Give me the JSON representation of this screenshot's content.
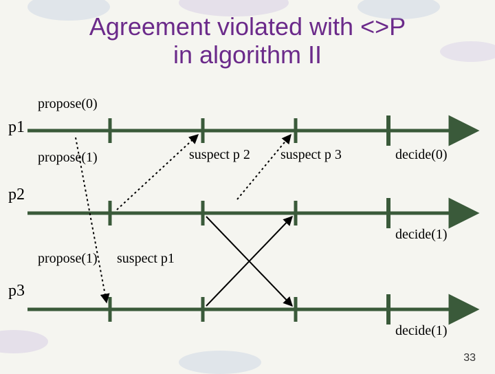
{
  "title_line1": "Agreement violated with <>P",
  "title_line2": "in algorithm II",
  "labels": {
    "propose0": "propose(0)",
    "propose1_a": "propose(1)",
    "propose1_b": "propose(1)",
    "suspect_p1": "suspect p1",
    "suspect_p2": "suspect p 2",
    "suspect_p3": "suspect p 3",
    "decide0": "decide(0)",
    "decide1_a": "decide(1)",
    "decide1_b": "decide(1)",
    "p1": "p1",
    "p2": "p2",
    "p3": "p3"
  },
  "page_number": "33",
  "chart_data": {
    "type": "timeline-diagram",
    "processes": [
      "p1",
      "p2",
      "p3"
    ],
    "rounds": 4,
    "events": [
      {
        "process": "p1",
        "action": "propose(0)"
      },
      {
        "process": "p2",
        "action": "propose(1)"
      },
      {
        "process": "p3",
        "action": "propose(1)"
      },
      {
        "process": "p1",
        "round": 2,
        "action": "suspect p2"
      },
      {
        "process": "p1",
        "round": 3,
        "action": "suspect p3"
      },
      {
        "process": "p3",
        "round": 1,
        "action": "suspect p1"
      },
      {
        "process": "p1",
        "round": 4,
        "action": "decide(0)"
      },
      {
        "process": "p2",
        "round": 4,
        "action": "decide(1)"
      },
      {
        "process": "p3",
        "round": 4,
        "action": "decide(1)"
      }
    ],
    "messages": [
      {
        "from": "p2",
        "to": "p1",
        "at_round": 2,
        "style": "dotted"
      },
      {
        "from": "p3",
        "to": "p1",
        "at_round": 3,
        "style": "dotted"
      },
      {
        "from": "p1",
        "to": "p3",
        "at_round": 1,
        "style": "dotted"
      },
      {
        "from": "p2",
        "to": "p3",
        "between_rounds": [
          2,
          3
        ],
        "style": "solid"
      },
      {
        "from": "p3",
        "to": "p2",
        "between_rounds": [
          2,
          3
        ],
        "style": "solid"
      }
    ]
  }
}
